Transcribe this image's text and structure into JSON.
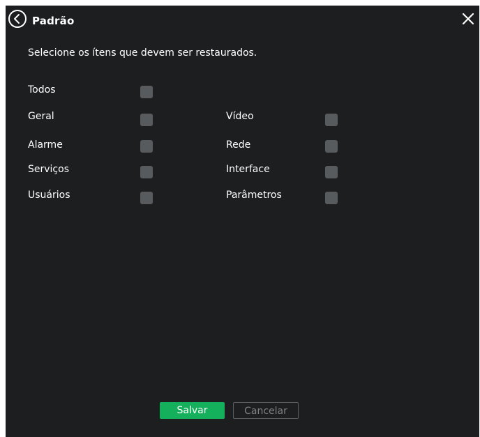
{
  "dialog": {
    "title": "Padrão",
    "instruction": "Selecione os ítens que devem ser restaurados."
  },
  "icons": {
    "back": "chevron-left-circle-icon",
    "close": "close-icon"
  },
  "options": {
    "todos": "Todos",
    "geral": "Geral",
    "video": "Vídeo",
    "alarme": "Alarme",
    "rede": "Rede",
    "servicos": "Serviços",
    "interface": "Interface",
    "usuarios": "Usuários",
    "parametros": "Parâmetros"
  },
  "checked": {
    "todos": false,
    "geral": false,
    "video": false,
    "alarme": false,
    "rede": false,
    "servicos": false,
    "interface": false,
    "usuarios": false,
    "parametros": false
  },
  "buttons": {
    "save": "Salvar",
    "cancel": "Cancelar"
  },
  "colors": {
    "background": "#1c1e1f",
    "checkbox": "#585b5e",
    "save_button": "#15b05b",
    "cancel_text": "#7f8386"
  }
}
